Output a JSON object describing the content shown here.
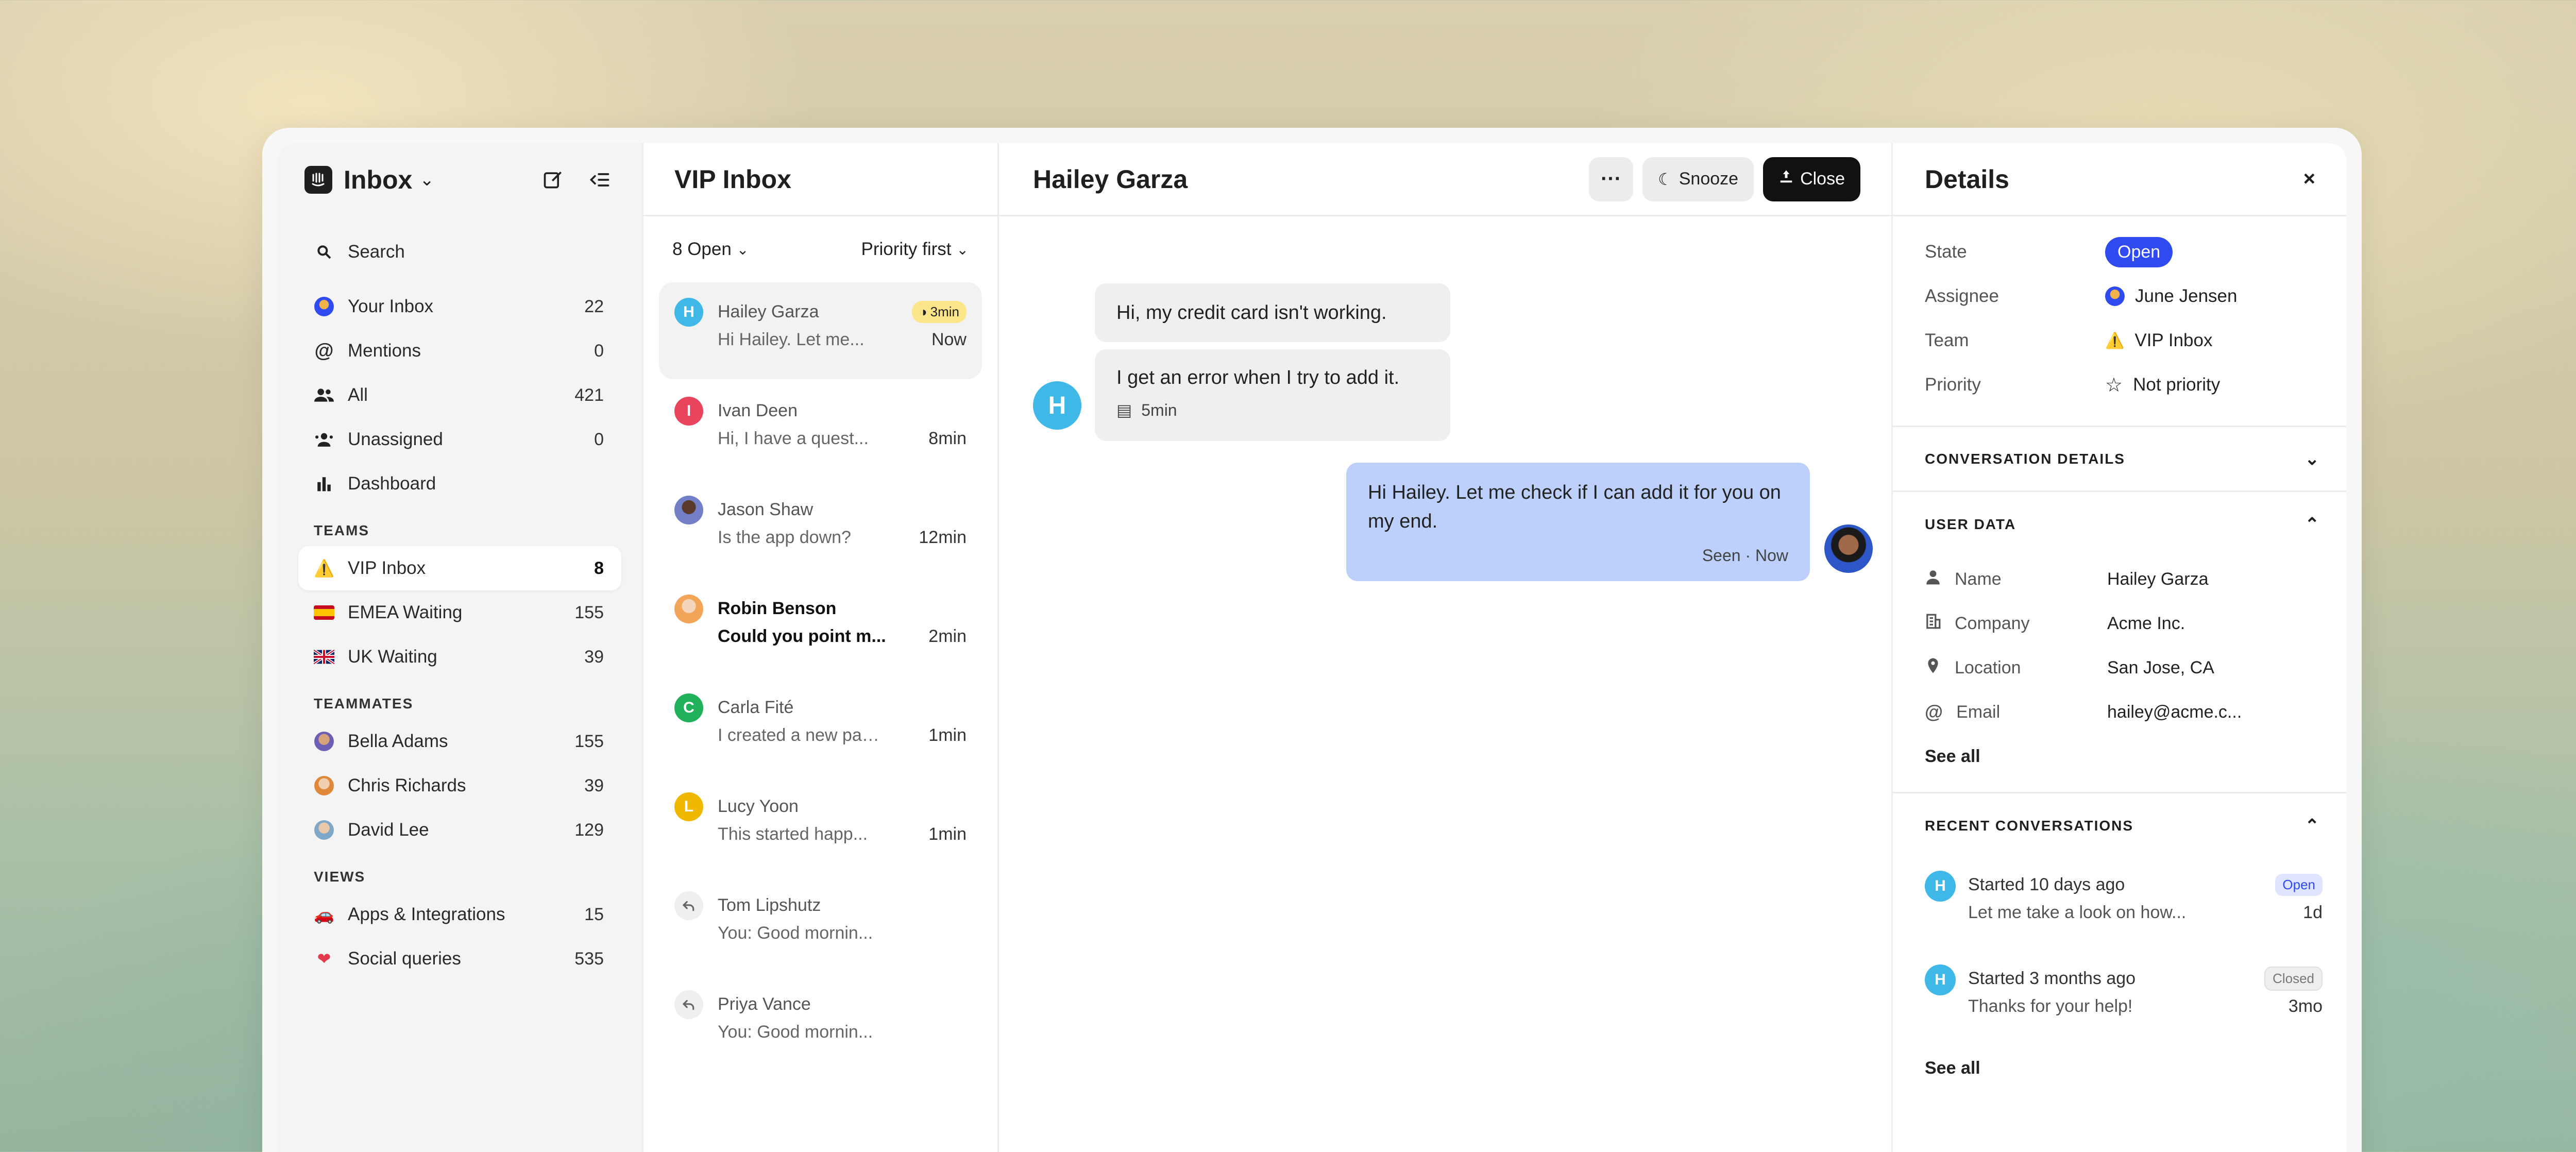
{
  "sidebar": {
    "title": "Inbox",
    "search": "Search",
    "items": [
      {
        "label": "Your Inbox",
        "count": "22"
      },
      {
        "label": "Mentions",
        "count": "0"
      },
      {
        "label": "All",
        "count": "421"
      },
      {
        "label": "Unassigned",
        "count": "0"
      },
      {
        "label": "Dashboard",
        "count": ""
      }
    ],
    "teams_heading": "TEAMS",
    "teams": [
      {
        "label": "VIP Inbox",
        "count": "8"
      },
      {
        "label": "EMEA Waiting",
        "count": "155"
      },
      {
        "label": "UK Waiting",
        "count": "39"
      }
    ],
    "teammates_heading": "TEAMMATES",
    "teammates": [
      {
        "label": "Bella Adams",
        "count": "155"
      },
      {
        "label": "Chris Richards",
        "count": "39"
      },
      {
        "label": "David Lee",
        "count": "129"
      }
    ],
    "views_heading": "VIEWS",
    "views": [
      {
        "label": "Apps & Integrations",
        "count": "15"
      },
      {
        "label": "Social queries",
        "count": "535"
      }
    ]
  },
  "inbox": {
    "title": "VIP Inbox",
    "filter_open": "8 Open",
    "filter_sort": "Priority first",
    "conversations": [
      {
        "initial": "H",
        "name": "Hailey Garza",
        "snippet": "Hi Hailey. Let me...",
        "time": "Now",
        "sla": "3min"
      },
      {
        "initial": "I",
        "name": "Ivan Deen",
        "snippet": "Hi, I have a quest...",
        "time": "8min"
      },
      {
        "initial": "",
        "name": "Jason Shaw",
        "snippet": "Is the app down?",
        "time": "12min"
      },
      {
        "initial": "",
        "name": "Robin Benson",
        "snippet": "Could you point m...",
        "time": "2min"
      },
      {
        "initial": "C",
        "name": "Carla Fité",
        "snippet": "I created a new page...",
        "time": "1min"
      },
      {
        "initial": "L",
        "name": "Lucy Yoon",
        "snippet": "This started happ...",
        "time": "1min"
      },
      {
        "initial": "",
        "name": "Tom Lipshutz",
        "snippet": "You: Good mornin...",
        "time": ""
      },
      {
        "initial": "",
        "name": "Priya Vance",
        "snippet": "You: Good mornin...",
        "time": ""
      }
    ]
  },
  "conversation": {
    "title": "Hailey Garza",
    "more_label": "···",
    "snooze_label": "Snooze",
    "close_label": "Close",
    "avatar_initial": "H",
    "messages": [
      {
        "text": "Hi, my credit card isn't working."
      },
      {
        "text": "I get an error when I try to add it.",
        "meta": "5min"
      },
      {
        "text": "Hi Hailey. Let me check if I can add it for you on my end.",
        "meta": "Seen · Now"
      }
    ]
  },
  "details": {
    "title": "Details",
    "close_label": "×",
    "state_label": "State",
    "state_value": "Open",
    "assignee_label": "Assignee",
    "assignee_value": "June Jensen",
    "team_label": "Team",
    "team_value": "VIP Inbox",
    "priority_label": "Priority",
    "priority_value": "Not priority",
    "conversation_details_heading": "CONVERSATION DETAILS",
    "user_data_heading": "USER DATA",
    "user_data": [
      {
        "label": "Name",
        "value": "Hailey Garza"
      },
      {
        "label": "Company",
        "value": "Acme Inc."
      },
      {
        "label": "Location",
        "value": "San Jose, CA"
      },
      {
        "label": "Email",
        "value": "hailey@acme.c..."
      }
    ],
    "see_all_label": "See all",
    "recent_heading": "RECENT CONVERSATIONS",
    "recent": [
      {
        "initial": "H",
        "title": "Started 10 days ago",
        "status": "Open",
        "snippet": "Let me take a look on how...",
        "age": "1d"
      },
      {
        "initial": "H",
        "title": "Started 3 months ago",
        "status": "Closed",
        "snippet": "Thanks for your help!",
        "age": "3mo"
      }
    ]
  },
  "colors": {
    "accent": "#2f4bf0",
    "outgoing_bubble": "#bcd0fb",
    "avatar_blue": "#3fb8e8"
  }
}
